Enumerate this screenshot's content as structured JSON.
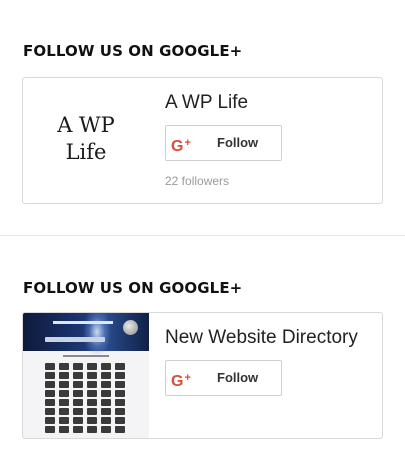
{
  "widgets": [
    {
      "title": "FOLLOW US ON GOOGLE+",
      "page_name": "A WP Life",
      "thumbnail_text": [
        "A WP",
        "Life"
      ],
      "button": {
        "icon_text": "G",
        "icon_sup": "+",
        "label": "Follow"
      },
      "followers": "22 followers"
    },
    {
      "title": "FOLLOW US ON GOOGLE+",
      "page_name": "New Website Directory",
      "button": {
        "icon_text": "G",
        "icon_sup": "+",
        "label": "Follow"
      }
    }
  ],
  "colors": {
    "google_red": "#dd4b39",
    "border": "#d9d9d9",
    "followers_text": "#9a9a9a"
  },
  "icons": [
    "google-plus-icon"
  ]
}
